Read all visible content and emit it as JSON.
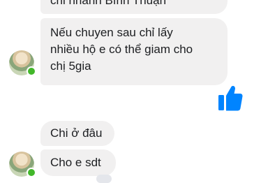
{
  "messages": {
    "top": "chi nhánh Bình Thuận",
    "main_line1": "Nếu chuyen sau chỉ lấy",
    "main_line2": "nhiều hộ e có thể giam cho",
    "main_line3": "chị 5gia",
    "where": "Chi ở đâu",
    "phone": "Cho e sdt"
  },
  "icons": {
    "like": "thumbs-up-icon",
    "avatar": "contact-avatar",
    "online": "online-status-dot"
  },
  "colors": {
    "bubble": "#f1f0f0",
    "text": "#1c1e21",
    "like": "#0084ff",
    "online": "#42b72a"
  }
}
